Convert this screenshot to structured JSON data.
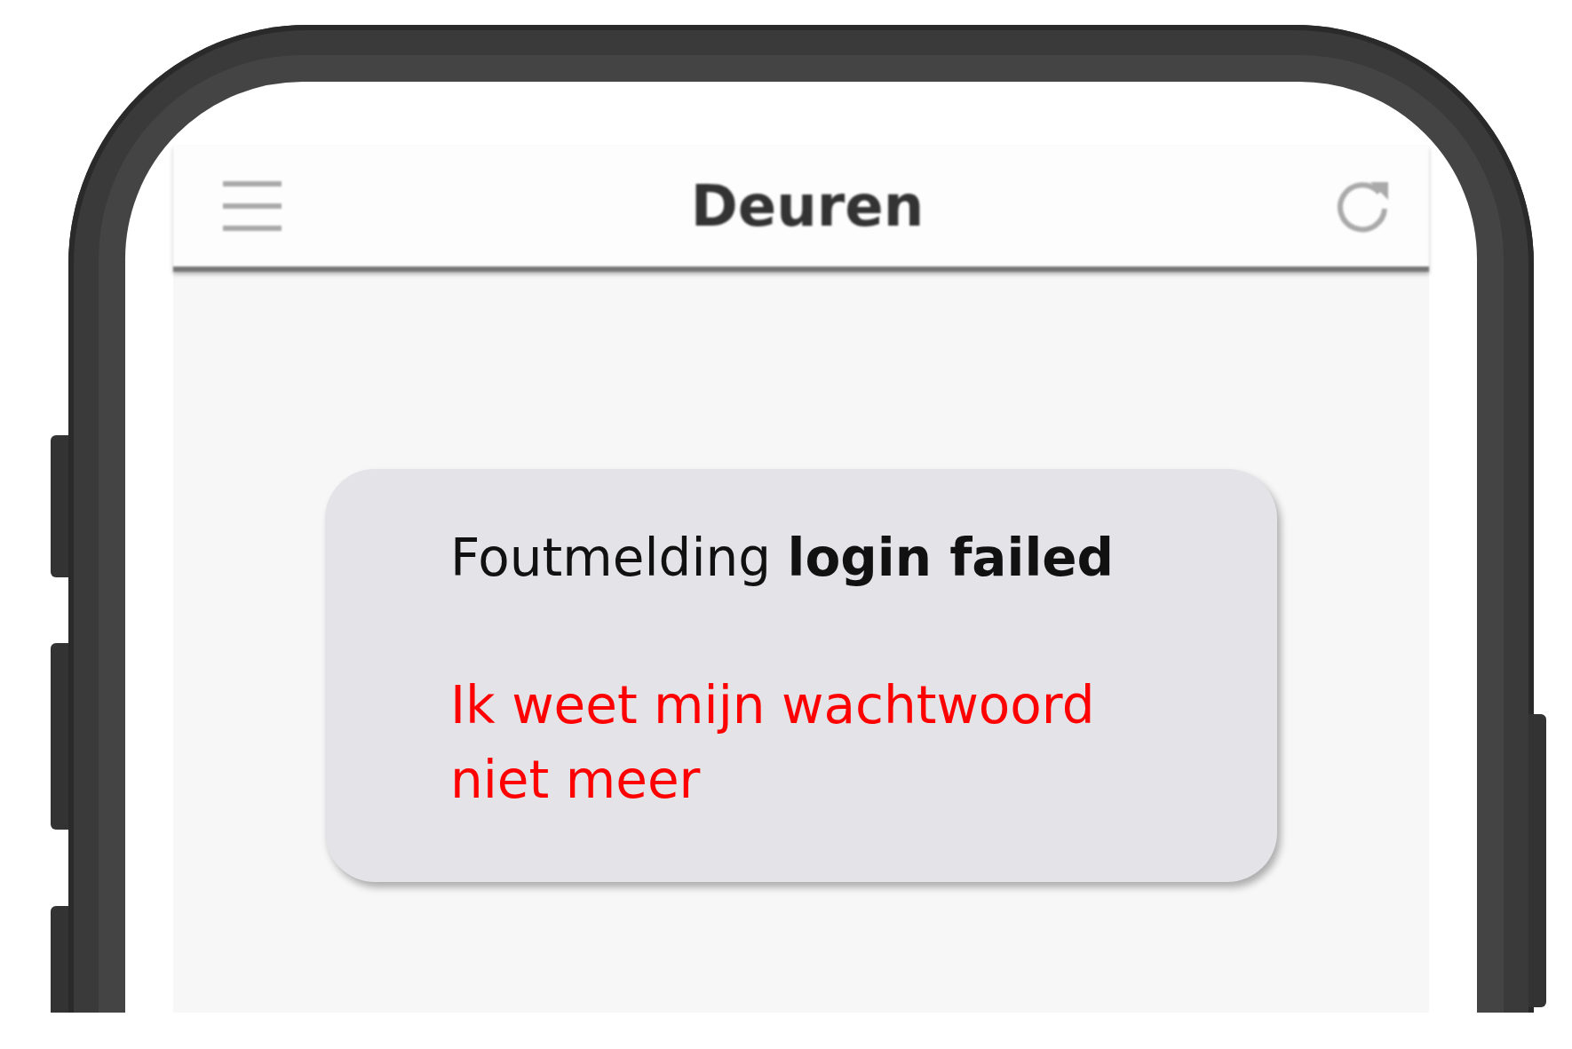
{
  "app_bar": {
    "title": "Deuren"
  },
  "dialog": {
    "message": "Foutmelding **login failed**",
    "link": "Ik weet mijn wachtwoord niet meer"
  }
}
